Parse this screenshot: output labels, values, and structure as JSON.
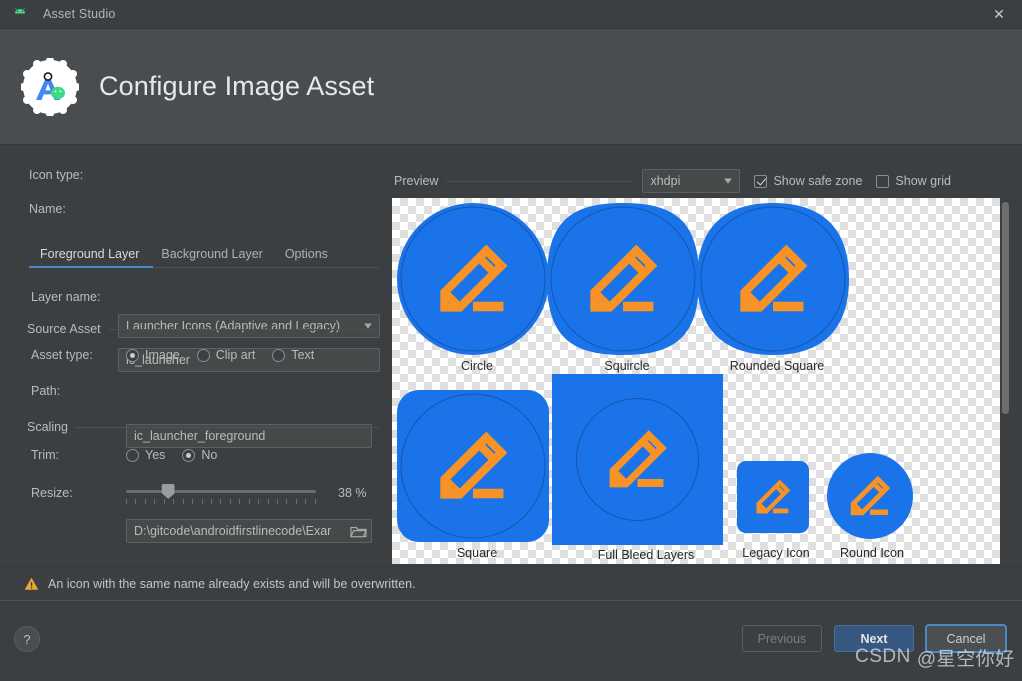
{
  "window": {
    "title": "Asset Studio",
    "app_icon": "android-icon",
    "close_label": "✕"
  },
  "header": {
    "title": "Configure Image Asset",
    "logo": "android-studio-logo"
  },
  "form": {
    "icon_type": {
      "label": "Icon type:",
      "value": "Launcher Icons (Adaptive and Legacy)"
    },
    "name": {
      "label": "Name:",
      "value": "ic_launcher"
    },
    "tabs": [
      {
        "label": "Foreground Layer",
        "active": true
      },
      {
        "label": "Background Layer",
        "active": false
      },
      {
        "label": "Options",
        "active": false
      }
    ],
    "layer_name": {
      "label": "Layer name:",
      "value": "ic_launcher_foreground"
    },
    "source_asset": {
      "section_label": "Source Asset",
      "asset_type": {
        "label": "Asset type:",
        "options": [
          "Image",
          "Clip art",
          "Text"
        ],
        "selected": "Image"
      },
      "path": {
        "label": "Path:",
        "value": "D:\\gitcode\\androidfirstlinecode\\Exar",
        "browse_icon": "folder-icon"
      }
    },
    "scaling": {
      "section_label": "Scaling",
      "trim": {
        "label": "Trim:",
        "options": [
          "Yes",
          "No"
        ],
        "selected": "No"
      },
      "resize": {
        "label": "Resize:",
        "value": "38 %",
        "percent": 38
      }
    }
  },
  "preview": {
    "label": "Preview",
    "density": {
      "value": "xhdpi"
    },
    "show_safe_zone": {
      "label": "Show safe zone",
      "checked": true
    },
    "show_grid": {
      "label": "Show grid",
      "checked": false
    },
    "tiles": [
      {
        "caption": "Circle"
      },
      {
        "caption": "Squircle"
      },
      {
        "caption": "Rounded Square"
      },
      {
        "caption": "Square"
      },
      {
        "caption": "Full Bleed Layers"
      },
      {
        "caption": "Legacy Icon"
      },
      {
        "caption": "Round Icon"
      }
    ],
    "colors": {
      "background": "#1a73e8",
      "foreground": "#f79326",
      "safe_zone_stroke": "#1456b0"
    }
  },
  "warning": {
    "icon": "warning-triangle-icon",
    "text": "An icon with the same name already exists and will be overwritten."
  },
  "footer": {
    "help_label": "?",
    "previous_label": "Previous",
    "next_label": "Next",
    "cancel_label": "Cancel"
  },
  "watermark": {
    "brand": "CSDN",
    "text": "@星空你好"
  }
}
